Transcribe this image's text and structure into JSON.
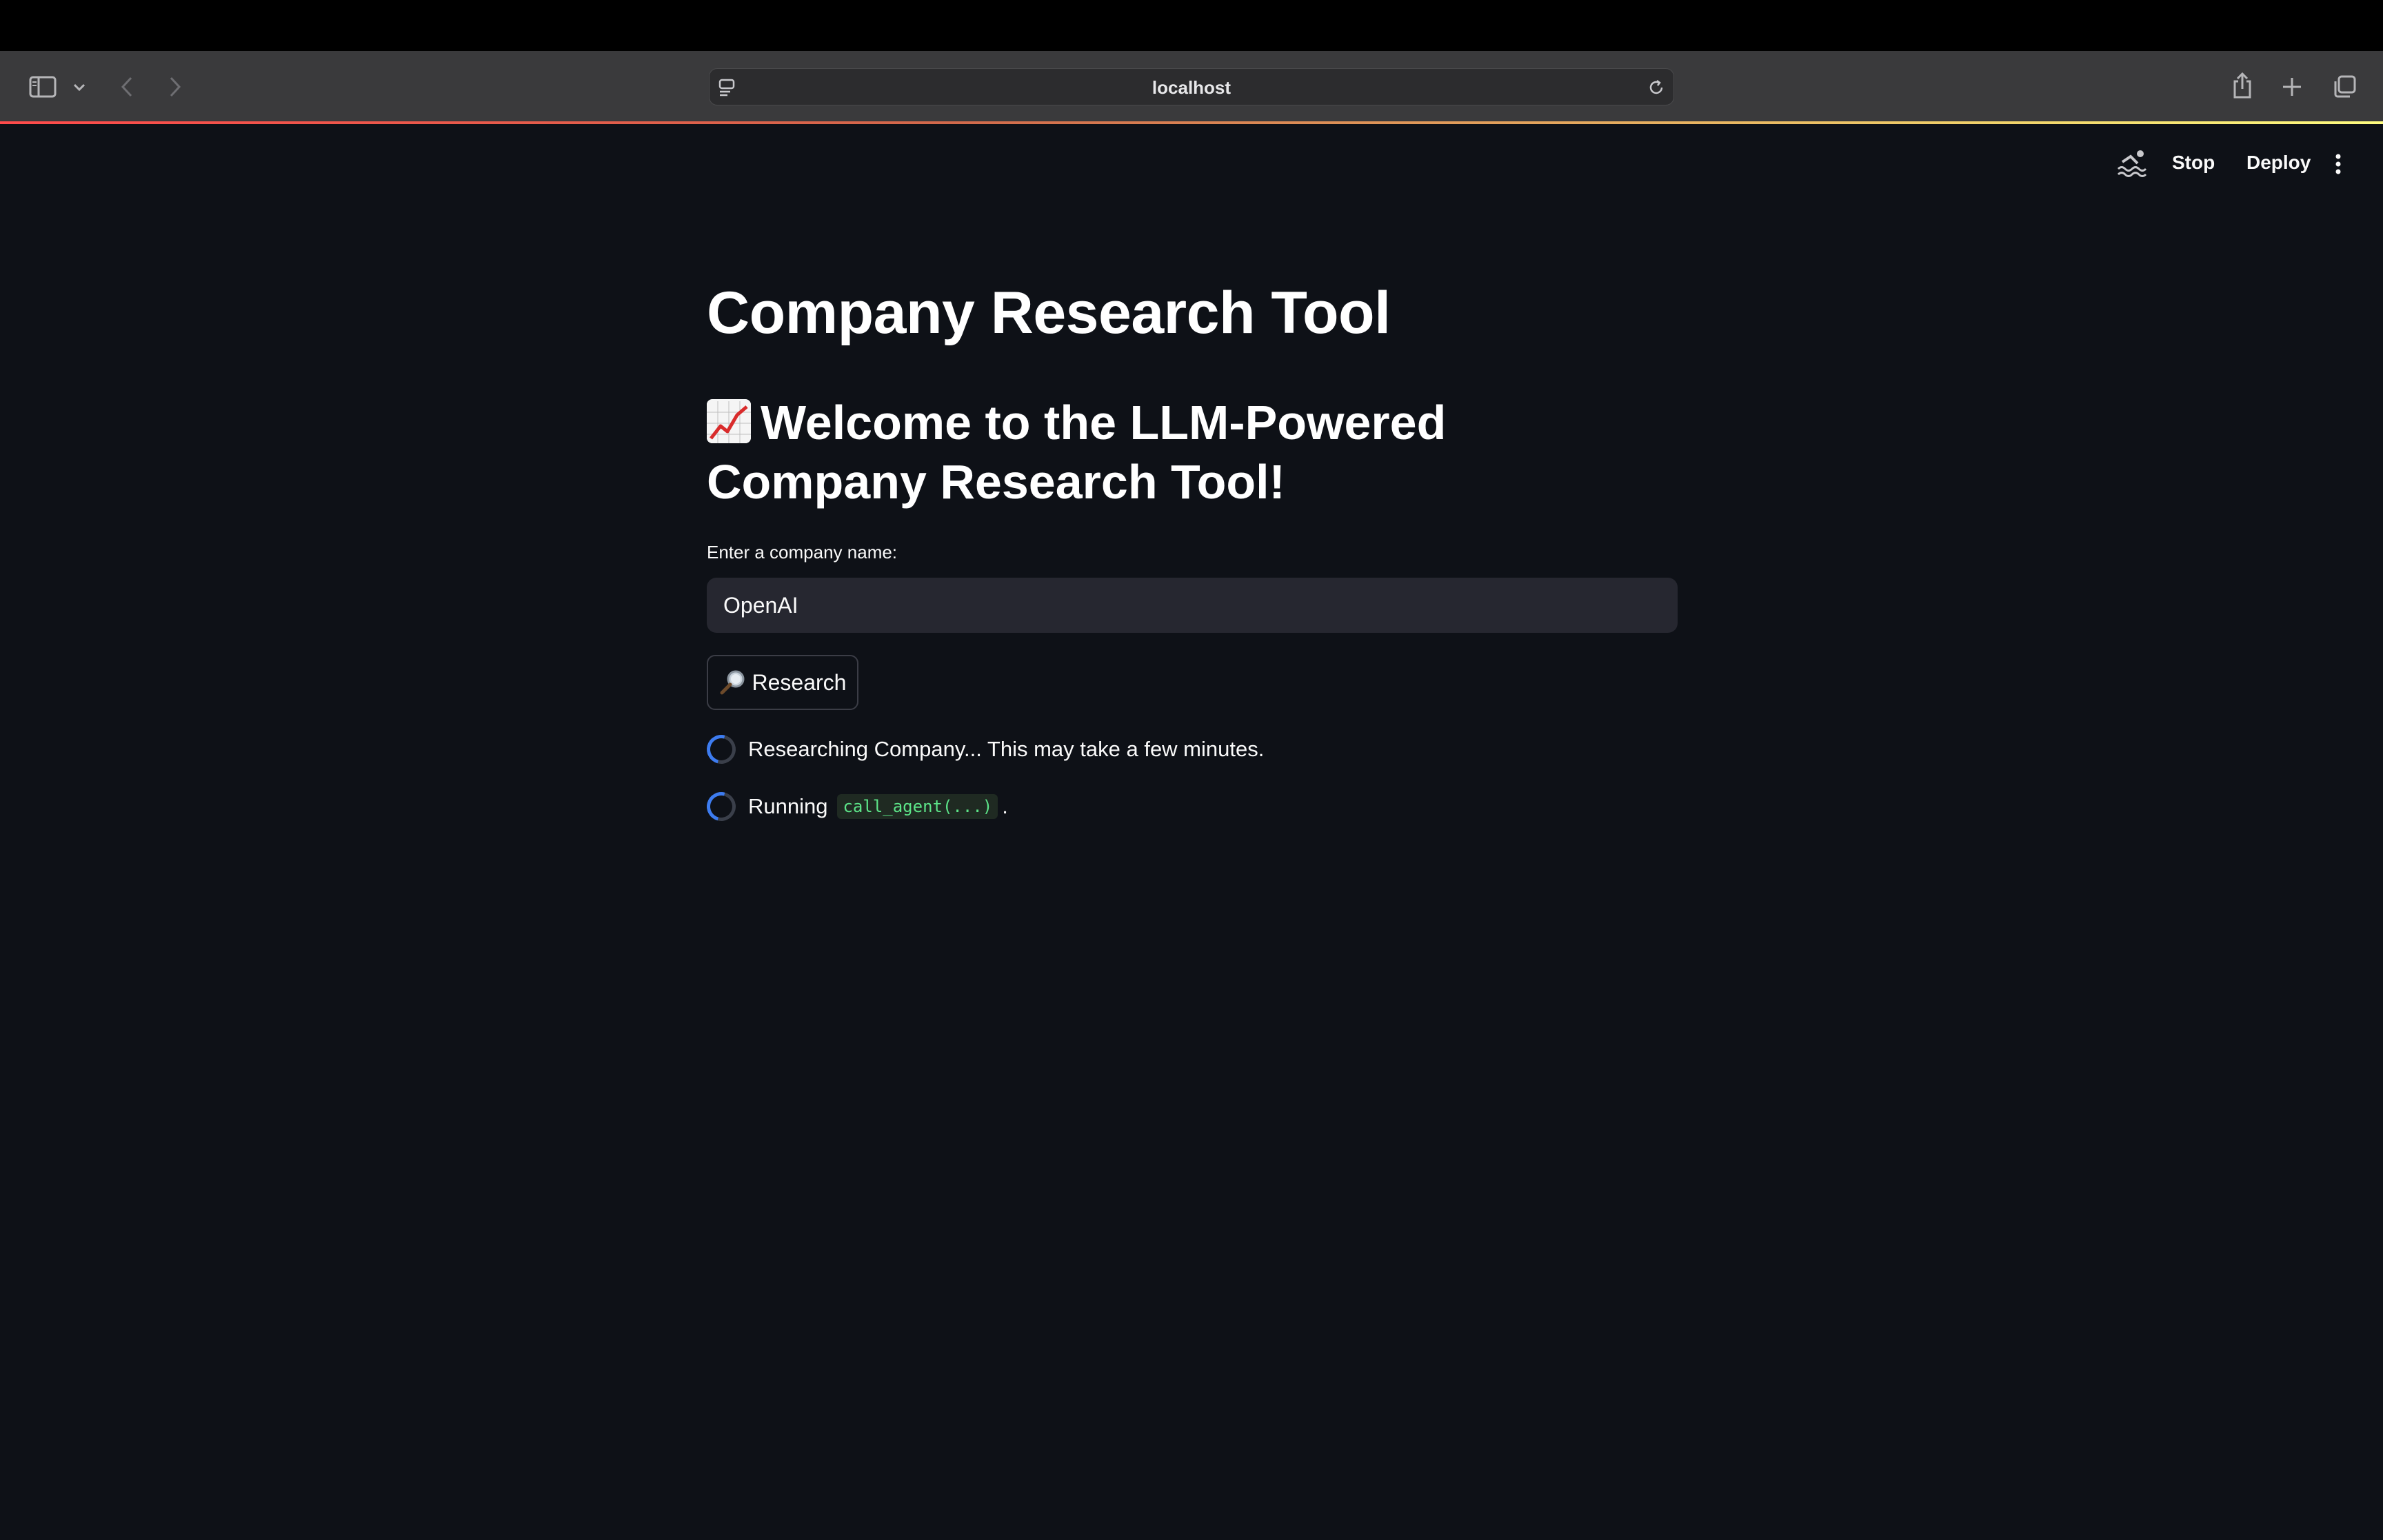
{
  "browser": {
    "address": "localhost"
  },
  "streamlit_header": {
    "stop_label": "Stop",
    "deploy_label": "Deploy"
  },
  "app": {
    "title": "Company Research Tool",
    "subheader_emoji": "chart-increasing-icon",
    "subheader_text": "Welcome to the LLM-Powered Company Research Tool!",
    "input_label": "Enter a company name:",
    "input_value": "OpenAI",
    "button_label": "Research",
    "button_icon": "magnifying-glass-icon",
    "status1": "Researching Company... This may take a few minutes.",
    "status2_prefix": "Running",
    "status2_code": "call_agent(...)",
    "status2_suffix": "."
  },
  "colors": {
    "background": "#0e1117",
    "input_bg": "#262730",
    "spinner": "#3d7cf0",
    "code_green": "#5ce488"
  }
}
